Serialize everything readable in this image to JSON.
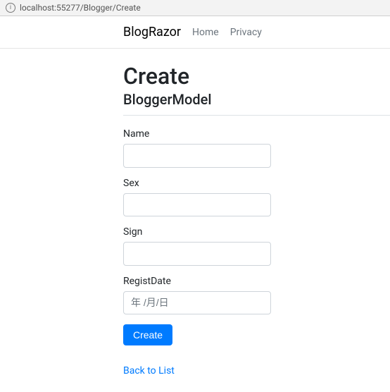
{
  "address_bar": {
    "url": "localhost:55277/Blogger/Create"
  },
  "nav": {
    "brand": "BlogRazor",
    "links": [
      {
        "label": "Home"
      },
      {
        "label": "Privacy"
      }
    ]
  },
  "page": {
    "title": "Create",
    "subtitle": "BloggerModel"
  },
  "form": {
    "fields": {
      "name": {
        "label": "Name",
        "value": ""
      },
      "sex": {
        "label": "Sex",
        "value": ""
      },
      "sign": {
        "label": "Sign",
        "value": ""
      },
      "registDate": {
        "label": "RegistDate",
        "value": "",
        "placeholder": "年 /月/日"
      }
    },
    "submit_label": "Create",
    "back_link_label": "Back to List"
  }
}
